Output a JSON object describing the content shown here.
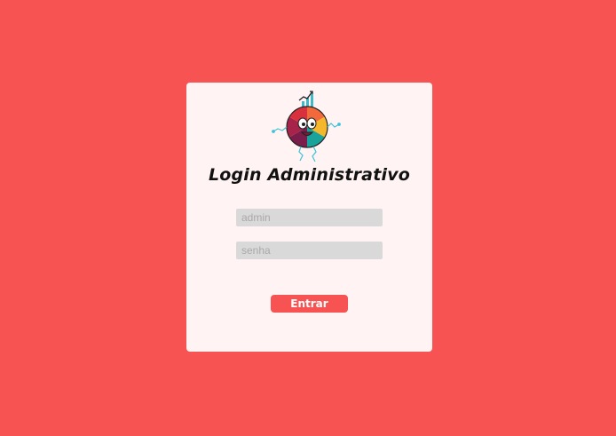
{
  "login": {
    "title": "Login Administrativo",
    "username_placeholder": "admin",
    "username_value": "",
    "password_placeholder": "senha",
    "password_value": "",
    "submit_label": "Entrar"
  },
  "colors": {
    "background": "#f75352",
    "card": "#fff4f3",
    "input": "#d9d9d9",
    "button": "#f75352",
    "button_text": "#ffffff"
  },
  "icons": {
    "logo": "pie-chart-mascot-logo"
  }
}
